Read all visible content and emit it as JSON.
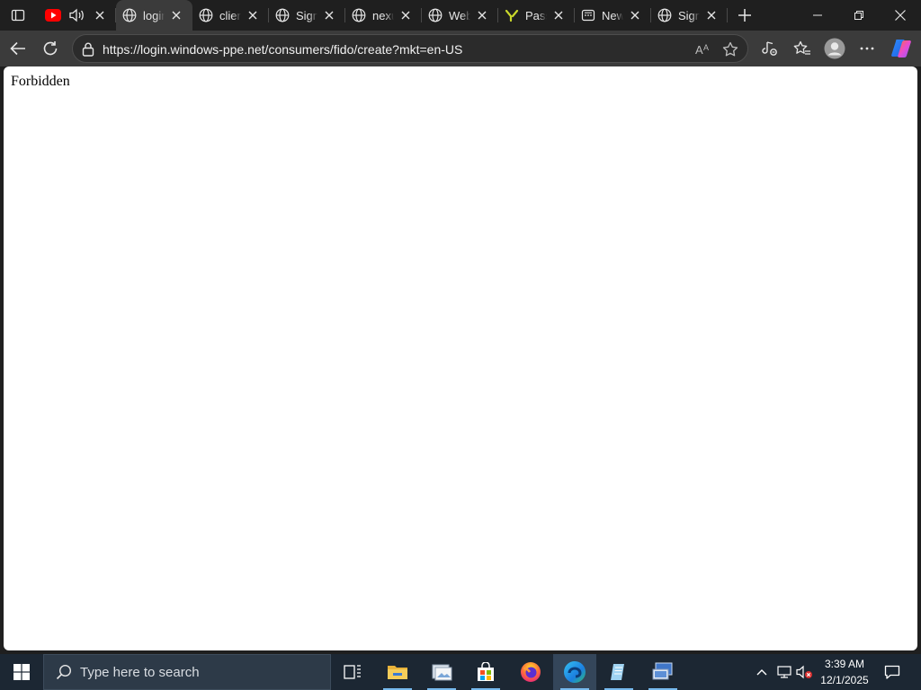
{
  "browser": {
    "tabs": [
      {
        "title": "",
        "favicon": "youtube-icon",
        "audio": true,
        "active": false
      },
      {
        "title": "login",
        "favicon": "globe-icon",
        "active": true
      },
      {
        "title": "client",
        "favicon": "globe-icon",
        "active": false
      },
      {
        "title": "Sign",
        "favicon": "globe-icon",
        "active": false
      },
      {
        "title": "nexu",
        "favicon": "globe-icon",
        "active": false
      },
      {
        "title": "Web",
        "favicon": "globe-icon",
        "active": false
      },
      {
        "title": "Pass",
        "favicon": "yubico-icon",
        "active": false
      },
      {
        "title": "New",
        "favicon": "new-tab-icon",
        "active": false
      },
      {
        "title": "Sign",
        "favicon": "globe-icon",
        "active": false
      }
    ],
    "address_bar": {
      "url": "https://login.windows-ppe.net/consumers/fido/create?mkt=en-US"
    }
  },
  "page": {
    "body_text": "Forbidden"
  },
  "taskbar": {
    "search_placeholder": "Type here to search",
    "time": "3:39 AM",
    "date": "12/1/2025",
    "apps": [
      "task-view",
      "file-explorer",
      "photos",
      "microsoft-store",
      "firefox",
      "edge",
      "notepad",
      "remote-desktop"
    ]
  },
  "colors": {
    "titlebar": "#1f1f1f",
    "toolbar": "#3b3b3b",
    "taskbar": "#1c2733",
    "accent": "#76b9ed"
  }
}
